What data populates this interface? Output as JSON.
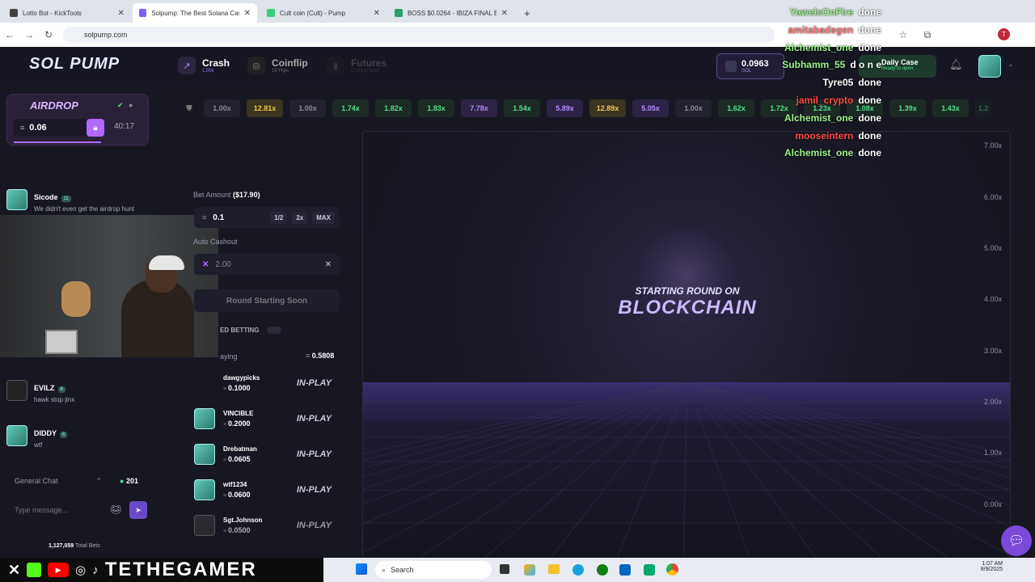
{
  "browser": {
    "tabs": [
      {
        "title": "Lotto Bot - KickTools",
        "active": false
      },
      {
        "title": "Solpump: The Best Solana Casi",
        "active": true
      },
      {
        "title": "Cult coin (Cult) - Pump",
        "active": false
      },
      {
        "title": "BOSS $0.0264 - IBIZA FINAL BO",
        "active": false
      }
    ],
    "new_tab": "+",
    "url": "solpump.com"
  },
  "nav": {
    "logo": "SOL PUMP",
    "crash_label": "Crash",
    "crash_sub": "1.00x",
    "coinflip_label": "Coinflip",
    "coinflip_sub": "18 Flips",
    "futures_label": "Futures",
    "futures_sub": "Coming soon",
    "balance": "0.0963",
    "balance_unit": "SOL",
    "daily_case": "Daily Case",
    "daily_case_sub": "Ready to open"
  },
  "sidebar": {
    "airdrop_title": "AIRDROP",
    "airdrop_amount": "0.06",
    "airdrop_timer": "40:17",
    "chat": [
      {
        "name": "Sicode",
        "level": "11",
        "text": "We didn't even get the airdrop hunt"
      },
      {
        "name": "EVILZ",
        "level": "6",
        "text": "hawk stop jinx"
      },
      {
        "name": "DIDDY",
        "level": "6",
        "text": "wtf"
      }
    ],
    "chat_channel": "General Chat",
    "online_count": "201",
    "message_placeholder": "Type message...",
    "total_bets": "1,127,059",
    "total_bets_label": "Total Bets"
  },
  "history": [
    "1.00x",
    "12.81x",
    "1.00x",
    "1.74x",
    "1.82x",
    "1.83x",
    "7.78x",
    "1.54x",
    "5.89x",
    "12.89x",
    "5.05x",
    "1.00x",
    "1.62x",
    "1.72x",
    "1.23x",
    "1.08x",
    "1.39x",
    "1.43x",
    "1.2"
  ],
  "bet": {
    "amount_label": "Bet Amount",
    "amount_usd": "($17.90)",
    "amount_value": "0.1",
    "half": "1/2",
    "double": "2x",
    "max": "MAX",
    "auto_label": "Auto Cashout",
    "auto_value": "2.00",
    "round_btn": "Round Starting Soon",
    "advanced": "ED BETTING",
    "playing_label": "aying",
    "playing_total": "0.5808",
    "players": [
      {
        "name": "dawgypicks",
        "bet": "0.1000",
        "status": "IN-PLAY"
      },
      {
        "name": "VINCIBLE",
        "bet": "0.2000",
        "status": "IN-PLAY"
      },
      {
        "name": "Drebatman",
        "bet": "0.0605",
        "status": "IN-PLAY"
      },
      {
        "name": "wtf1234",
        "bet": "0.0600",
        "status": "IN-PLAY"
      },
      {
        "name": "Sgt.Johnson",
        "bet": "0.0500",
        "status": "IN-PLAY"
      }
    ]
  },
  "game": {
    "line1": "STARTING ROUND ON",
    "line2": "BLOCKCHAIN",
    "y_labels": [
      "7.00x",
      "6.00x",
      "5.00x",
      "4.00x",
      "3.00x",
      "2.00x",
      "1.00x",
      "0.00x"
    ]
  },
  "overlay_chat": [
    {
      "name": "YawelsOnFire",
      "msg": "done",
      "color": "#9cf28a"
    },
    {
      "name": "amitabadegen",
      "msg": "done",
      "color": "#ff7a7a"
    },
    {
      "name": "Alchemist_one",
      "msg": "done",
      "color": "#9cf28a"
    },
    {
      "name": "Subhamm_55",
      "msg": "d o n e",
      "color": "#9cf28a"
    },
    {
      "name": "Tyre05",
      "msg": "done",
      "color": "#ffffff"
    },
    {
      "name": "jamil_crypto",
      "msg": "done",
      "color": "#ff4a4a"
    },
    {
      "name": "Alchemist_one",
      "msg": "done",
      "color": "#9cf28a"
    },
    {
      "name": "mooseintern",
      "msg": "done",
      "color": "#ff4a4a"
    },
    {
      "name": "Alchemist_one",
      "msg": "done",
      "color": "#9cf28a"
    }
  ],
  "stream_banner": "TETHEGAMER",
  "taskbar": {
    "search": "Search",
    "time": "1:07 AM",
    "date": "8/9/2025"
  }
}
